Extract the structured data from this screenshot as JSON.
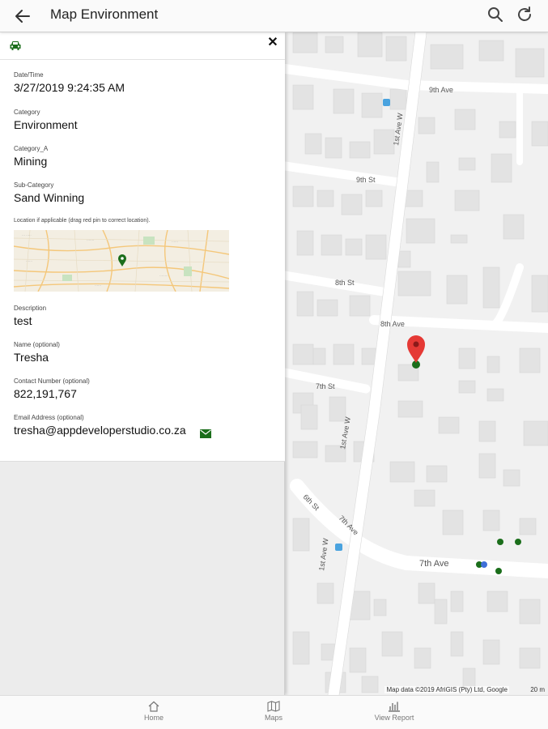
{
  "header": {
    "title": "Map Environment",
    "back_icon": "arrow-left-icon",
    "search_icon": "search-icon",
    "refresh_icon": "refresh-icon"
  },
  "detail": {
    "date_time": {
      "label": "Date/Time",
      "value": "3/27/2019 9:24:35 AM"
    },
    "category": {
      "label": "Category",
      "value": "Environment"
    },
    "category_a": {
      "label": "Category_A",
      "value": "Mining"
    },
    "sub_category": {
      "label": "Sub-Category",
      "value": "Sand Winning"
    },
    "location": {
      "label": "Location if applicable (drag red pin to correct location)."
    },
    "description": {
      "label": "Description",
      "value": "test"
    },
    "name": {
      "label": "Name (optional)",
      "value": "Tresha"
    },
    "contact": {
      "label": "Contact Number (optional)",
      "value": "822,191,767"
    },
    "email": {
      "label": "Email Address (optional)",
      "value": "tresha@appdeveloperstudio.co.za"
    }
  },
  "map": {
    "streets": [
      "9th Ave",
      "9th St",
      "8th St",
      "8th Ave",
      "7th St",
      "6th St",
      "7th Ave",
      "7th Ave",
      "1st Ave W",
      "1st Ave W",
      "1st Ave W"
    ],
    "attribution": "Map data ©2019 AfriGIS (Pty) Ltd, Google",
    "scale": "20 m"
  },
  "bottom_nav": [
    {
      "label": "Home",
      "icon": "home-icon"
    },
    {
      "label": "Maps",
      "icon": "map-icon"
    },
    {
      "label": "View Report",
      "icon": "report-icon"
    }
  ],
  "colors": {
    "accent": "#1b6e1b",
    "pin": "#e53935"
  }
}
